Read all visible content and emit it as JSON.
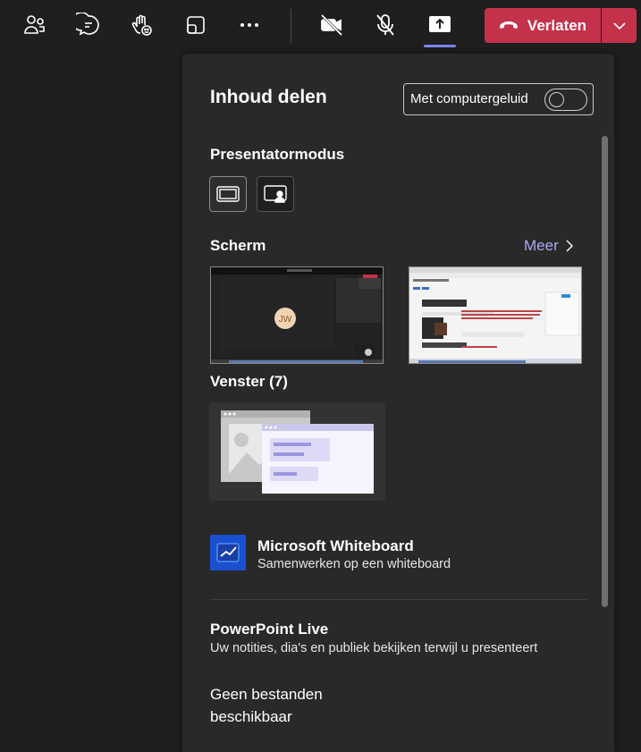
{
  "topbar": {
    "icons": [
      "people-icon",
      "chat-icon",
      "raise-hand-icon",
      "layout-icon",
      "more-icon",
      "camera-off-icon",
      "mic-off-icon",
      "share-icon"
    ],
    "leave_label": "Verlaten",
    "accent_color": "#7f85f5",
    "leave_color": "#c4314b"
  },
  "panel": {
    "title": "Inhoud delen",
    "sound_toggle": {
      "label": "Met computergeluid",
      "state": "off"
    },
    "presenter_mode": {
      "heading": "Presentatormodus",
      "options": [
        "content-only-mode",
        "standout-mode"
      ]
    },
    "screen": {
      "heading": "Scherm",
      "more_label": "Meer",
      "thumbs": [
        {
          "avatar_initials": "JW"
        },
        {}
      ]
    },
    "windows": {
      "heading": "Venster (7)"
    },
    "whiteboard": {
      "title": "Microsoft Whiteboard",
      "subtitle": "Samenwerken op een whiteboard"
    },
    "powerpoint": {
      "title": "PowerPoint Live",
      "subtitle": "Uw notities, dia's en publiek bekijken terwijl u presenteert",
      "empty_line1": "Geen bestanden",
      "empty_line2": "beschikbaar"
    }
  }
}
